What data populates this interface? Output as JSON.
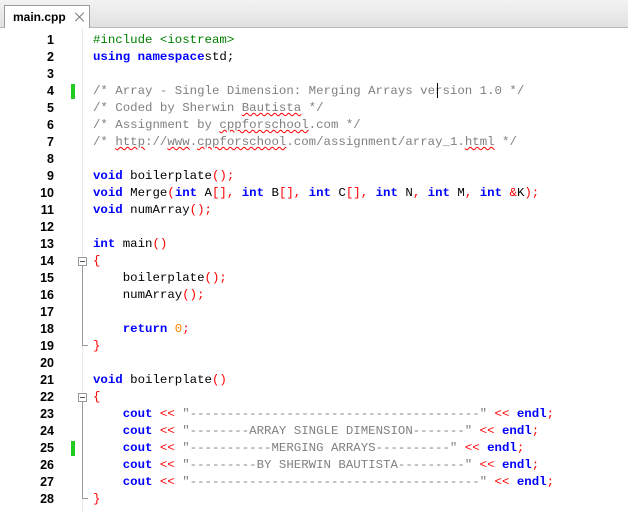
{
  "tab": {
    "label": "main.cpp",
    "close_icon": "close-icon"
  },
  "colors": {
    "change_marker": "#22cc22",
    "keyword": "#0000ff",
    "preprocessor": "#008000",
    "operator": "#ff0000",
    "number": "#ff8000",
    "comment": "#808080"
  },
  "lines": [
    {
      "n": "1",
      "tokens": [
        [
          "pre",
          "#include <iostream>"
        ]
      ]
    },
    {
      "n": "2",
      "tokens": [
        [
          "kw",
          "using namespace"
        ],
        [
          "",
          "std;"
        ]
      ]
    },
    {
      "n": "3",
      "tokens": []
    },
    {
      "n": "4",
      "marked": true,
      "tokens": [
        [
          "cmt",
          "/* Array - Single Dimension: Merging Arrays version 1.0 */"
        ]
      ]
    },
    {
      "n": "5",
      "tokens": [
        [
          "cmt",
          "/* Coded by Sherwin "
        ],
        [
          "cmt sq",
          "Bautista"
        ],
        [
          "cmt",
          " */"
        ]
      ]
    },
    {
      "n": "6",
      "tokens": [
        [
          "cmt",
          "/* Assignment by "
        ],
        [
          "cmt sq",
          "cppforschool"
        ],
        [
          "cmt",
          ".com */"
        ]
      ]
    },
    {
      "n": "7",
      "tokens": [
        [
          "cmt",
          "/* "
        ],
        [
          "cmt sq",
          "http"
        ],
        [
          "cmt",
          "://"
        ],
        [
          "cmt sq",
          "www"
        ],
        [
          "cmt",
          "."
        ],
        [
          "cmt sq",
          "cppforschool"
        ],
        [
          "cmt",
          ".com/assignment/array_1."
        ],
        [
          "cmt sq",
          "html"
        ],
        [
          "cmt",
          " */"
        ]
      ]
    },
    {
      "n": "8",
      "tokens": []
    },
    {
      "n": "9",
      "tokens": [
        [
          "kw",
          "void"
        ],
        [
          "",
          " boilerplate"
        ],
        [
          "op",
          "();"
        ]
      ]
    },
    {
      "n": "10",
      "tokens": [
        [
          "kw",
          "void"
        ],
        [
          "",
          " Merge"
        ],
        [
          "op",
          "("
        ],
        [
          "kw",
          "int"
        ],
        [
          "",
          " A"
        ],
        [
          "op",
          "[],"
        ],
        [
          " ",
          ""
        ],
        [
          "kw",
          " int"
        ],
        [
          "",
          " B"
        ],
        [
          "op",
          "[],"
        ],
        [
          "kw",
          " int"
        ],
        [
          "",
          " C"
        ],
        [
          "op",
          "[],"
        ],
        [
          "kw",
          " int"
        ],
        [
          "",
          " N"
        ],
        [
          "op",
          ","
        ],
        [
          "kw",
          " int"
        ],
        [
          "",
          " M"
        ],
        [
          "op",
          ","
        ],
        [
          "kw",
          " int"
        ],
        [
          "op",
          " &"
        ],
        [
          "",
          "K"
        ],
        [
          "op",
          ");"
        ]
      ]
    },
    {
      "n": "11",
      "tokens": [
        [
          "kw",
          "void"
        ],
        [
          "",
          " numArray"
        ],
        [
          "op",
          "();"
        ]
      ]
    },
    {
      "n": "12",
      "tokens": []
    },
    {
      "n": "13",
      "tokens": [
        [
          "kw",
          "int"
        ],
        [
          "",
          " main"
        ],
        [
          "op",
          "()"
        ]
      ]
    },
    {
      "n": "14",
      "tokens": [
        [
          "op",
          "{"
        ]
      ]
    },
    {
      "n": "15",
      "tokens": [
        [
          "",
          "    boilerplate"
        ],
        [
          "op",
          "();"
        ]
      ]
    },
    {
      "n": "16",
      "tokens": [
        [
          "",
          "    numArray"
        ],
        [
          "op",
          "();"
        ]
      ]
    },
    {
      "n": "17",
      "tokens": []
    },
    {
      "n": "18",
      "tokens": [
        [
          "kw",
          "    return"
        ],
        [
          "num",
          " 0"
        ],
        [
          "op",
          ";"
        ]
      ]
    },
    {
      "n": "19",
      "tokens": [
        [
          "op",
          "}"
        ]
      ]
    },
    {
      "n": "20",
      "tokens": []
    },
    {
      "n": "21",
      "tokens": [
        [
          "kw",
          "void"
        ],
        [
          "",
          " boilerplate"
        ],
        [
          "op",
          "()"
        ]
      ]
    },
    {
      "n": "22",
      "tokens": [
        [
          "op",
          "{"
        ]
      ]
    },
    {
      "n": "23",
      "tokens": [
        [
          "kw",
          "    cout"
        ],
        [
          "op",
          " <<"
        ],
        [
          "str",
          " \"---------------------------------------\""
        ],
        [
          "op",
          " <<"
        ],
        [
          "kw",
          " endl"
        ],
        [
          "op",
          ";"
        ]
      ]
    },
    {
      "n": "24",
      "tokens": [
        [
          "kw",
          "    cout"
        ],
        [
          "op",
          " <<"
        ],
        [
          "str",
          " \"--------ARRAY SINGLE DIMENSION-------\""
        ],
        [
          "op",
          " <<"
        ],
        [
          "kw",
          " endl"
        ],
        [
          "op",
          ";"
        ]
      ]
    },
    {
      "n": "25",
      "marked": true,
      "tokens": [
        [
          "kw",
          "    cout"
        ],
        [
          "op",
          " <<"
        ],
        [
          "str",
          " \"-----------MERGING ARRAYS----------\""
        ],
        [
          "op",
          " <<"
        ],
        [
          "kw",
          " endl"
        ],
        [
          "op",
          ";"
        ]
      ]
    },
    {
      "n": "26",
      "tokens": [
        [
          "kw",
          "    cout"
        ],
        [
          "op",
          " <<"
        ],
        [
          "str",
          " \"---------BY SHERWIN BAUTISTA---------\""
        ],
        [
          "op",
          " <<"
        ],
        [
          "kw",
          " endl"
        ],
        [
          "op",
          ";"
        ]
      ]
    },
    {
      "n": "27",
      "tokens": [
        [
          "kw",
          "    cout"
        ],
        [
          "op",
          " <<"
        ],
        [
          "str",
          " \"---------------------------------------\""
        ],
        [
          "op",
          " <<"
        ],
        [
          "kw",
          " endl"
        ],
        [
          "op",
          ";"
        ]
      ]
    },
    {
      "n": "28",
      "tokens": [
        [
          "op",
          "}"
        ]
      ]
    }
  ]
}
